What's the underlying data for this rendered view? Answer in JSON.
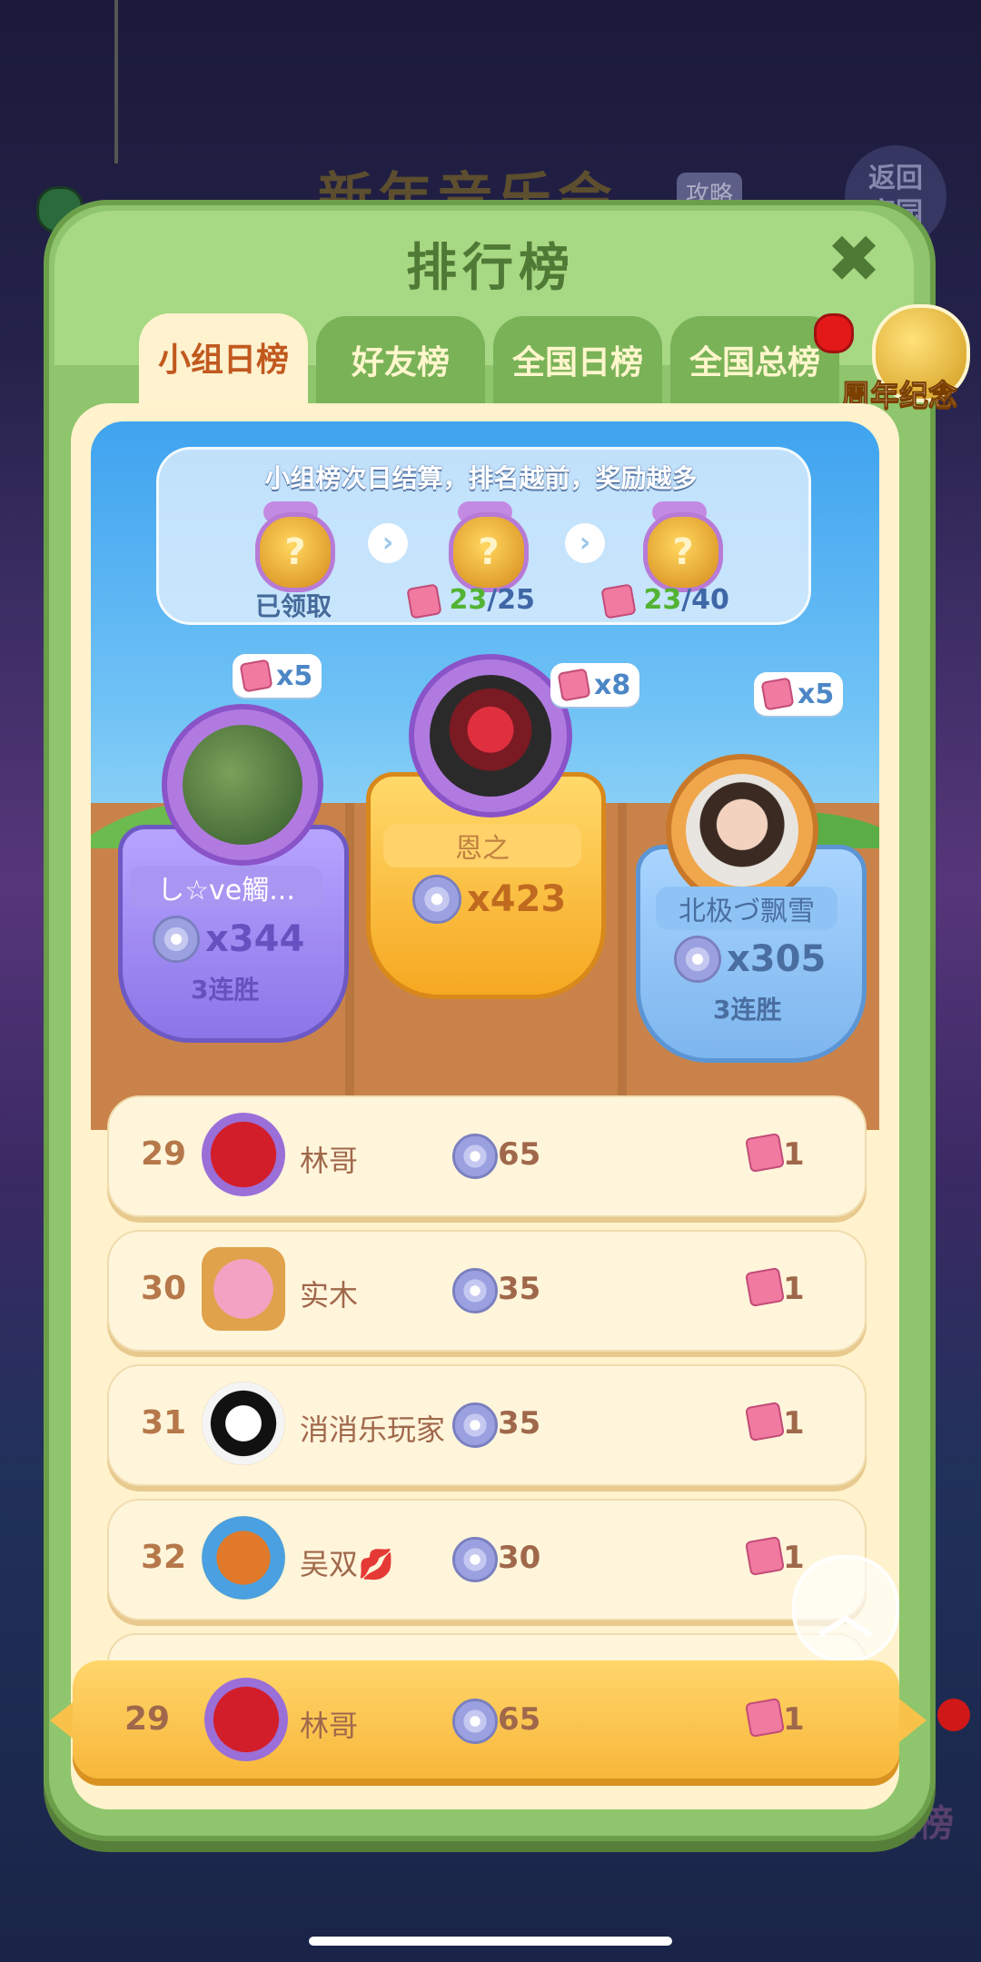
{
  "background": {
    "event_title": "新年音乐会",
    "event_tag": "攻略",
    "back_button": "返回\n家园",
    "bottom_label": "话花榜"
  },
  "panel": {
    "title": "排行榜",
    "close_icon": "close-x"
  },
  "tabs": [
    {
      "label": "小组日榜",
      "active": true
    },
    {
      "label": "好友榜",
      "active": false
    },
    {
      "label": "全国日榜",
      "active": false
    },
    {
      "label": "全国总榜",
      "active": false
    }
  ],
  "anniversary": {
    "label": "周年纪念币"
  },
  "rewards": {
    "title": "小组榜次日结算，排名越前，奖励越多",
    "tiers": [
      {
        "status": "已领取"
      },
      {
        "current": "23",
        "total": "/25"
      },
      {
        "current": "23",
        "total": "/40"
      }
    ]
  },
  "podium": [
    {
      "place": 2,
      "name": "し☆ve觸...",
      "score": "x344",
      "streak": "3连胜",
      "fragments": "x5"
    },
    {
      "place": 1,
      "name": "恩之",
      "score": "x423",
      "streak": "",
      "fragments": "x8"
    },
    {
      "place": 3,
      "name": "北极づ飘雪",
      "score": "x305",
      "streak": "3连胜",
      "fragments": "x5"
    }
  ],
  "rows": [
    {
      "rank": "29",
      "name": "林哥",
      "score": "65",
      "fragments": "1"
    },
    {
      "rank": "30",
      "name": "实木",
      "score": "35",
      "fragments": "1"
    },
    {
      "rank": "31",
      "name": "消消乐玩家",
      "score": "35",
      "fragments": "1"
    },
    {
      "rank": "32",
      "name": "吴双💋",
      "score": "30",
      "fragments": "1"
    }
  ],
  "my_row": {
    "rank": "29",
    "name": "林哥",
    "score": "65",
    "fragments": "1"
  },
  "colors": {
    "panel_green": "#8fc56d",
    "tab_active_text": "#c1591f",
    "row_text": "#a0684b",
    "highlight_bar": "#f8b73a"
  }
}
